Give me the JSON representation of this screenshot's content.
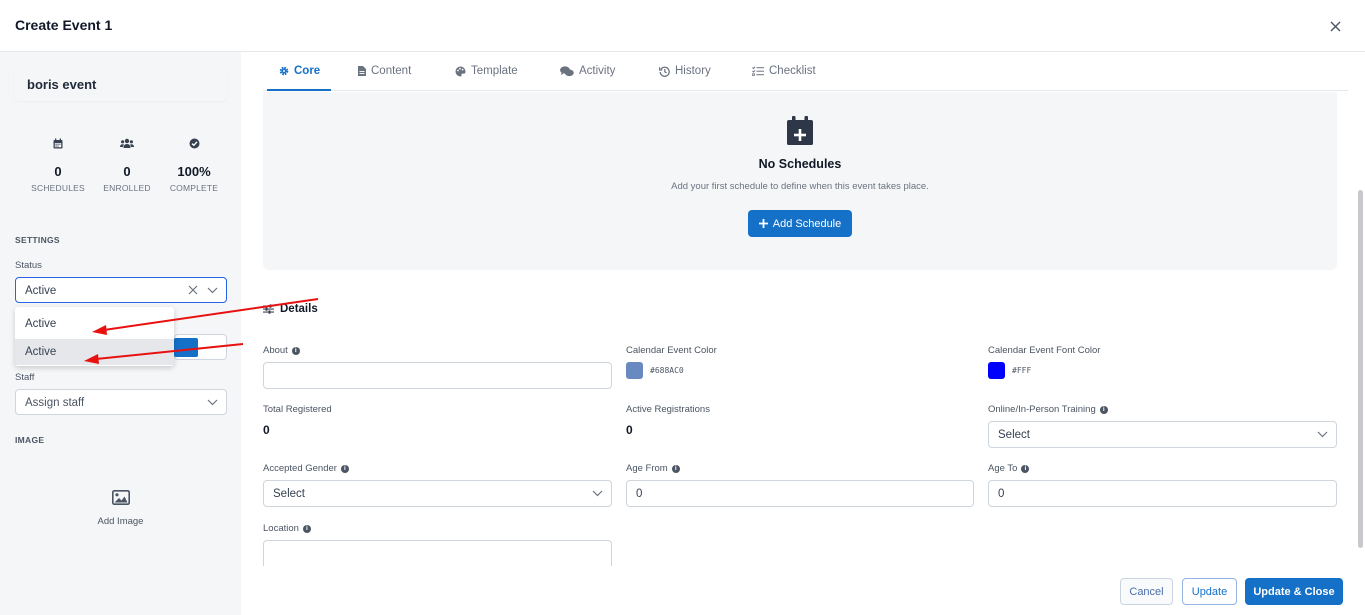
{
  "modal": {
    "title": "Create Event 1"
  },
  "sidebar": {
    "event_name": "boris event",
    "stats": [
      {
        "icon": "calendar-icon",
        "value": "0",
        "label": "SCHEDULES"
      },
      {
        "icon": "users-icon",
        "value": "0",
        "label": "ENROLLED"
      },
      {
        "icon": "check-circle-icon",
        "value": "100%",
        "label": "COMPLETE"
      }
    ],
    "settings_title": "SETTINGS",
    "status_label": "Status",
    "status_value": "Active",
    "status_options": [
      "Active",
      "Active"
    ],
    "staff_label": "Staff",
    "staff_placeholder": "Assign staff",
    "image_title": "IMAGE",
    "add_image_label": "Add Image"
  },
  "tabs": [
    {
      "label": "Core",
      "icon": "gear-icon",
      "active": true
    },
    {
      "label": "Content",
      "icon": "file-icon",
      "active": false
    },
    {
      "label": "Template",
      "icon": "palette-icon",
      "active": false
    },
    {
      "label": "Activity",
      "icon": "comments-icon",
      "active": false
    },
    {
      "label": "History",
      "icon": "history-icon",
      "active": false
    },
    {
      "label": "Checklist",
      "icon": "checklist-icon",
      "active": false
    }
  ],
  "schedules": {
    "title": "No Schedules",
    "description": "Add your first schedule to define when this event takes place.",
    "add_button": "Add Schedule"
  },
  "details": {
    "title": "Details",
    "about_label": "About",
    "about_value": "",
    "calendar_color_label": "Calendar Event Color",
    "calendar_color_value": "#688AC0",
    "font_color_label": "Calendar Event Font Color",
    "font_color_value": "#FFF",
    "font_color_swatch": "#0000ff",
    "total_registered_label": "Total Registered",
    "total_registered_value": "0",
    "active_registrations_label": "Active Registrations",
    "active_registrations_value": "0",
    "training_label": "Online/In-Person Training",
    "training_placeholder": "Select",
    "gender_label": "Accepted Gender",
    "gender_placeholder": "Select",
    "age_from_label": "Age From",
    "age_from_value": "0",
    "age_to_label": "Age To",
    "age_to_value": "0",
    "location_label": "Location",
    "location_value": ""
  },
  "footer": {
    "cancel": "Cancel",
    "update": "Update",
    "update_close": "Update & Close"
  },
  "colors": {
    "primary": "#1570c7",
    "annotation_arrow": "#e8110f"
  }
}
